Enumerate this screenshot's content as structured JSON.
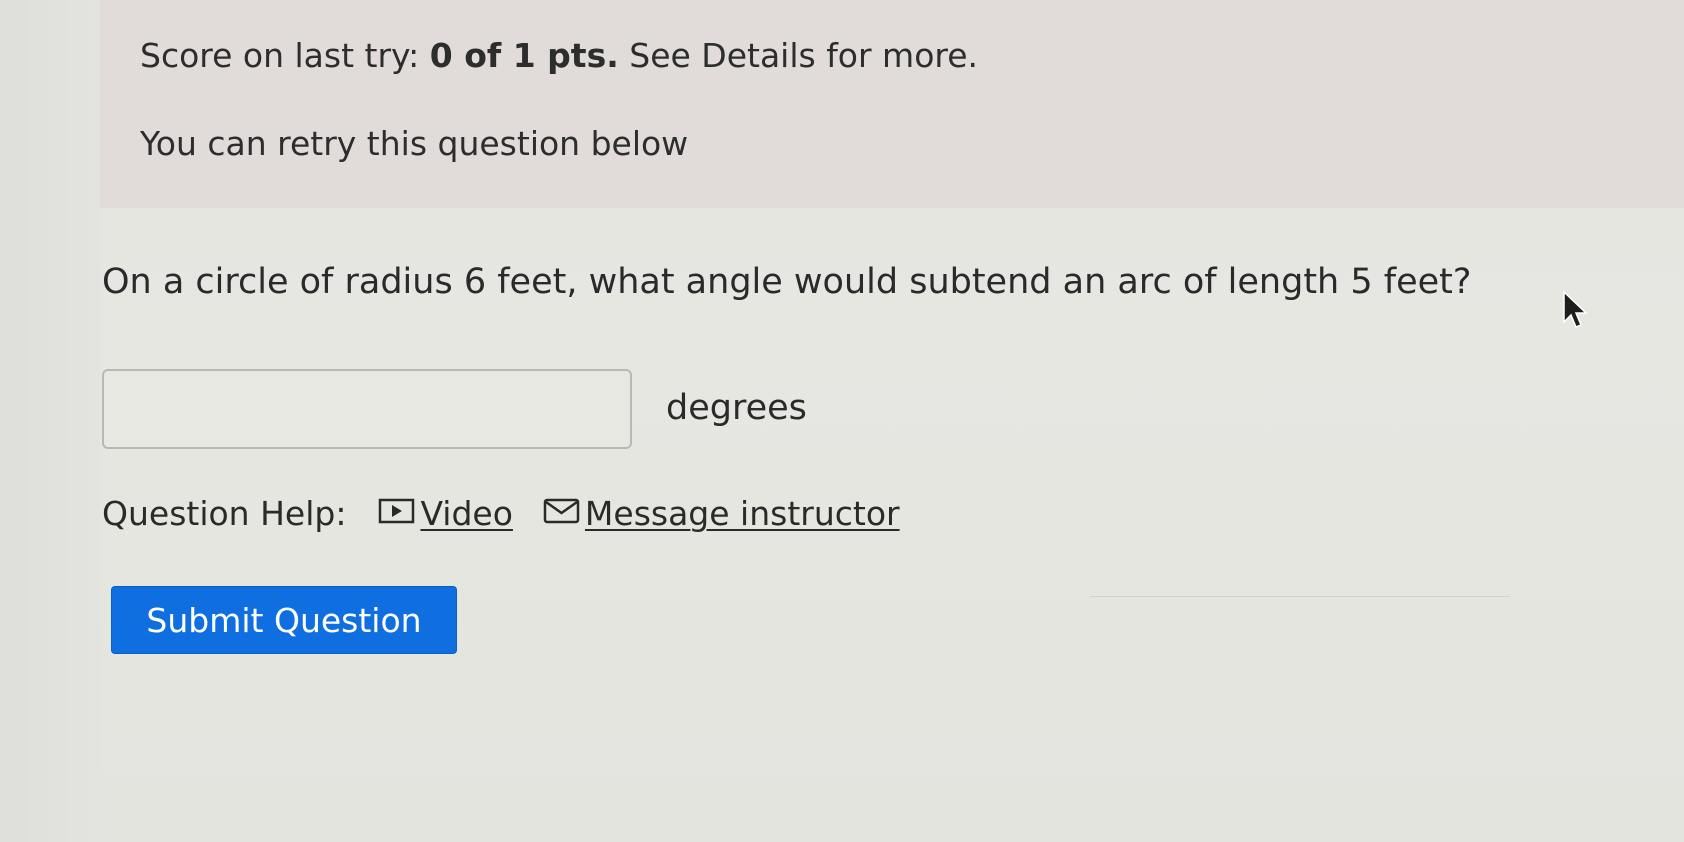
{
  "feedback": {
    "score_prefix": "Score on last try: ",
    "score_value": "0 of 1 pts.",
    "score_suffix": " See Details for more.",
    "retry_text": "You can retry this question below"
  },
  "question": {
    "text": "On a circle of radius 6 feet, what angle would subtend an arc of length 5 feet?"
  },
  "answer": {
    "value": "",
    "placeholder": "",
    "units": "degrees"
  },
  "help": {
    "label": "Question Help:",
    "video_label": "Video",
    "video_icon": "play-video-icon",
    "message_label": "Message instructor",
    "message_icon": "envelope-icon"
  },
  "actions": {
    "submit_label": "Submit Question"
  },
  "colors": {
    "submit_bg": "#0f6fe0",
    "feedback_bg": "#e1dcda",
    "page_bg": "#e6e6e1"
  }
}
